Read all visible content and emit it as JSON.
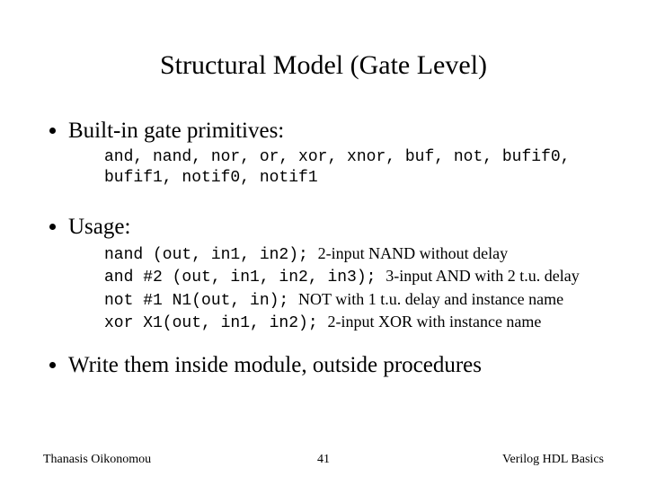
{
  "title": "Structural Model (Gate Level)",
  "bullets": {
    "b1": "Built-in gate primitives:",
    "b2": "Usage:",
    "b3": "Write them inside module, outside procedures"
  },
  "primitives_code": "and, nand, nor, or, xor, xnor, buf, not, bufif0, bufif1, notif0, notif1",
  "usage": {
    "l1_code": "nand (out, in1, in2); ",
    "l1_text": "2-input NAND without delay",
    "l2_code": "and #2 (out, in1, in2, in3); ",
    "l2_text": "3-input AND with 2 t.u. delay",
    "l3_code": "not #1 N1(out, in); ",
    "l3_text": "NOT with 1 t.u. delay and instance name",
    "l4_code": "xor X1(out, in1, in2); ",
    "l4_text": "2-input XOR with instance name"
  },
  "footer": {
    "left": "Thanasis Oikonomou",
    "center": "41",
    "right": "Verilog HDL Basics"
  }
}
